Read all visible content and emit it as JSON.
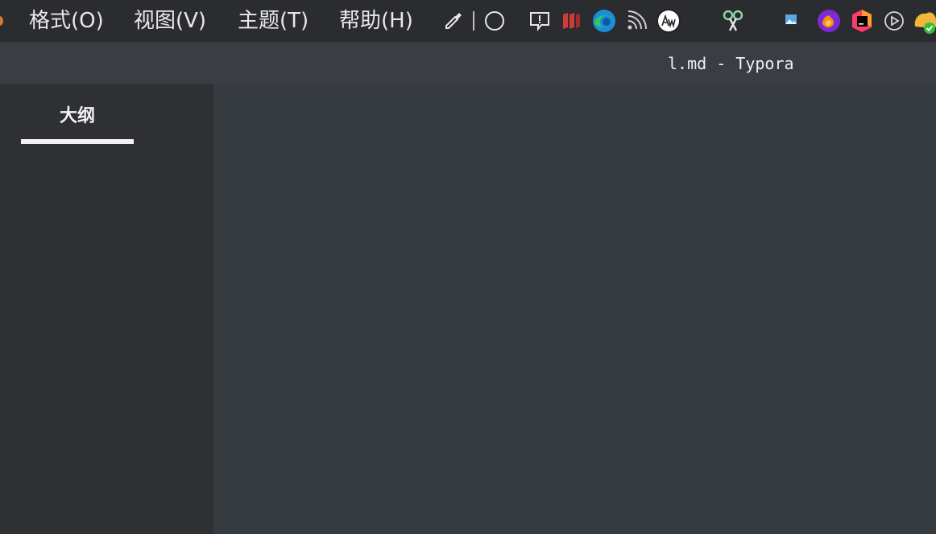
{
  "menubar": {
    "items": [
      {
        "label": "格式(O)"
      },
      {
        "label": "视图(V)"
      },
      {
        "label": "主题(T)"
      },
      {
        "label": "帮助(H)"
      }
    ],
    "tray_icons": [
      "eyedropper-icon",
      "separator",
      "circle-icon",
      "feedback-icon",
      "parallels-icon",
      "edge-icon",
      "rss-icon",
      "aw-icon",
      "scissors-icon",
      "photos-icon",
      "firefox-icon",
      "jetbrains-icon",
      "play-icon",
      "sync-icon"
    ]
  },
  "window": {
    "title": "l.md - Typora"
  },
  "sidebar": {
    "tab_label": "大纲"
  },
  "colors": {
    "menubar_bg": "#2b2c30",
    "titlebar_bg": "#3a3d43",
    "sidebar_bg": "#2e3034",
    "editor_bg": "#363B40"
  }
}
